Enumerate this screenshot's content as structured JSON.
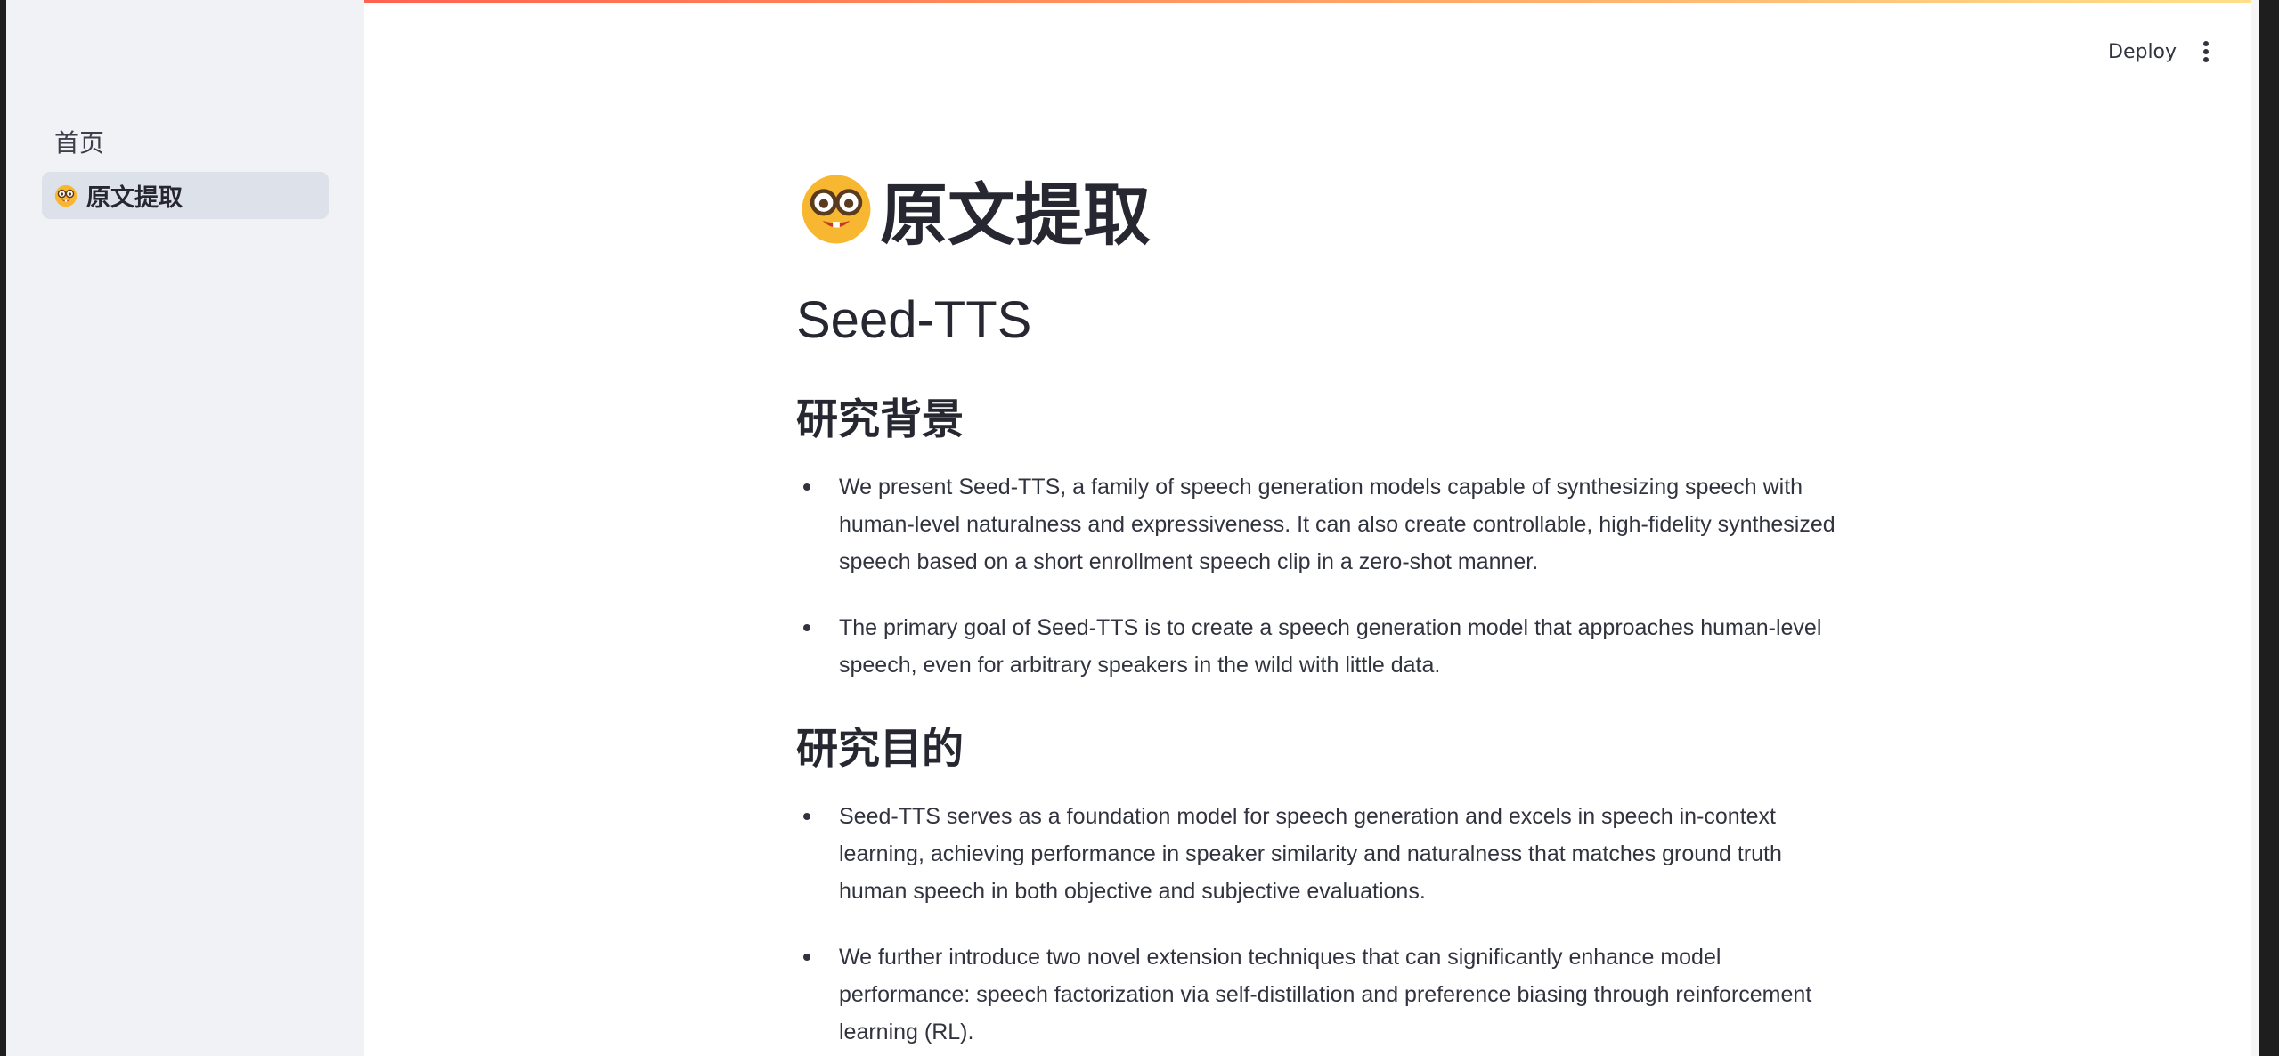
{
  "sidebar": {
    "items": [
      {
        "label": "首页"
      },
      {
        "label": "原文提取",
        "icon": "nerd-face-icon",
        "active": true
      }
    ]
  },
  "toolbar": {
    "deploy_label": "Deploy",
    "menu_icon": "vertical-ellipsis-icon"
  },
  "main": {
    "page_title": "原文提取",
    "page_title_icon": "nerd-face-icon",
    "heading": "Seed-TTS",
    "sections": [
      {
        "title": "研究背景",
        "bullets": [
          "We present Seed-TTS, a family of speech generation models capable of synthesizing speech with human-level naturalness and expressiveness. It can also create controllable, high-fidelity synthesized speech based on a short enrollment speech clip in a zero-shot manner.",
          "The primary goal of Seed-TTS is to create a speech generation model that approaches human-level speech, even for arbitrary speakers in the wild with little data."
        ]
      },
      {
        "title": "研究目的",
        "bullets": [
          "Seed-TTS serves as a foundation model for speech generation and excels in speech in-context learning, achieving performance in speaker similarity and naturalness that matches ground truth human speech in both objective and subjective evaluations.",
          "We further introduce two novel extension techniques that can significantly enhance model performance: speech factorization via self-distillation and preference biasing through reinforcement learning (RL)."
        ]
      }
    ]
  },
  "colors": {
    "sidebar_bg": "#f0f2f6",
    "active_item_bg": "#dde1ea",
    "text": "#31333f",
    "decoration_start": "#ff4b4b",
    "decoration_end": "#ffe08a"
  }
}
